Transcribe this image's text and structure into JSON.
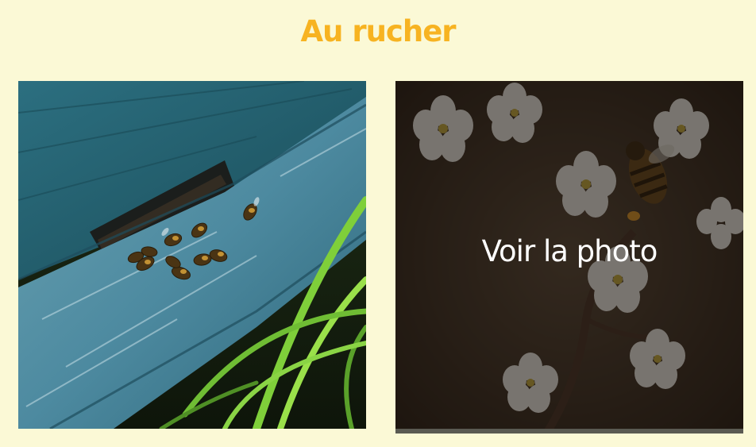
{
  "section": {
    "title": "Au rucher"
  },
  "gallery": {
    "photos": [
      {
        "subject": "bees-on-hive-entrance",
        "hovered": false
      },
      {
        "subject": "bee-on-blossoms",
        "hovered": true,
        "overlay_label": "Voir la photo"
      }
    ]
  },
  "colors": {
    "background": "#fbf9d6",
    "title": "#f7b321",
    "overlay_text": "#ffffff"
  }
}
